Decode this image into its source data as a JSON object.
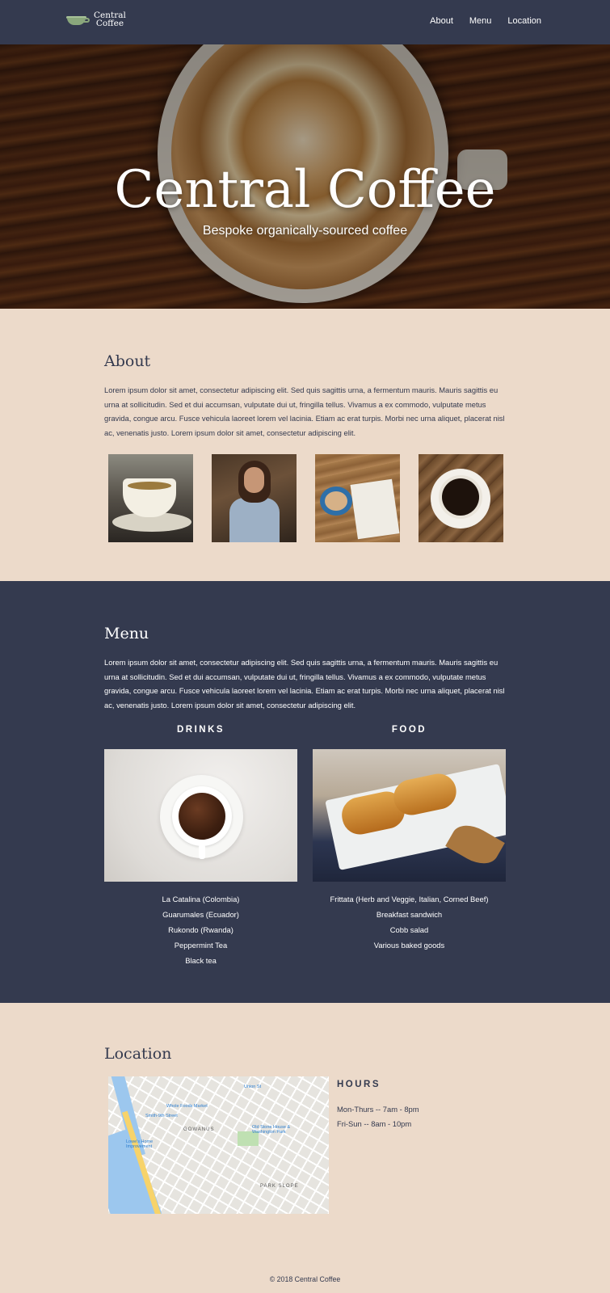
{
  "nav": {
    "logo_line1": "Central",
    "logo_line2": "Coffee",
    "links": [
      "About",
      "Menu",
      "Location"
    ]
  },
  "hero": {
    "title": "Central Coffee",
    "subtitle": "Bespoke organically-sourced coffee"
  },
  "about": {
    "heading": "About",
    "text": "Lorem ipsum dolor sit amet, consectetur adipiscing elit. Sed quis sagittis urna, a fermentum mauris. Mauris sagittis eu urna at sollicitudin. Sed et dui accumsan, vulputate dui ut, fringilla tellus. Vivamus a ex commodo, vulputate metus gravida, congue arcu. Fusce vehicula laoreet lorem vel lacinia. Etiam ac erat turpis. Morbi nec urna aliquet, placerat nisl ac, venenatis justo. Lorem ipsum dolor sit amet, consectetur adipiscing elit."
  },
  "menu": {
    "heading": "Menu",
    "text": "Lorem ipsum dolor sit amet, consectetur adipiscing elit. Sed quis sagittis urna, a fermentum mauris. Mauris sagittis eu urna at sollicitudin. Sed et dui accumsan, vulputate dui ut, fringilla tellus. Vivamus a ex commodo, vulputate metus gravida, congue arcu. Fusce vehicula laoreet lorem vel lacinia. Etiam ac erat turpis. Morbi nec urna aliquet, placerat nisl ac, venenatis justo. Lorem ipsum dolor sit amet, consectetur adipiscing elit.",
    "drinks": {
      "title": "DRINKS",
      "items": [
        "La Catalina (Colombia)",
        "Guarumales (Ecuador)",
        "Rukondo (Rwanda)",
        "Peppermint Tea",
        "Black tea"
      ]
    },
    "food": {
      "title": "FOOD",
      "items": [
        "Frittata (Herb and Veggie, Italian, Corned Beef)",
        "Breakfast sandwich",
        "Cobb salad",
        "Various baked goods"
      ]
    }
  },
  "location": {
    "heading": "Location",
    "map_labels": {
      "gowanus": "GOWANUS",
      "park_slope": "PARK SLOPE",
      "union": "Union St",
      "whole_foods": "Whole Foods Market",
      "smith": "Smith-9th Street",
      "old_stone": "Old Stone House & Washington Park",
      "lowes": "Lowe's Home Improvement"
    },
    "hours_title": "HOURS",
    "hours": [
      "Mon-Thurs -- 7am - 8pm",
      "Fri-Sun -- 8am - 10pm"
    ]
  },
  "footer": {
    "text": "© 2018 Central Coffee"
  },
  "colors": {
    "navy": "#343a4f",
    "cream": "#ecdaca",
    "logo_green": "#8aa77c"
  }
}
